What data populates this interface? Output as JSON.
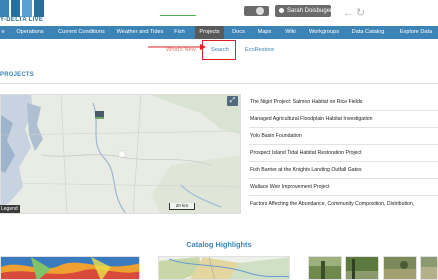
{
  "header": {
    "logo_subtitle": "Y-DELTA LIVE",
    "user_button_label": "Sarah Doisbuger",
    "icons": {
      "toggle": "toggle-switch-icon",
      "user": "user-icon",
      "back": "back-arrow-icon",
      "refresh": "refresh-icon"
    }
  },
  "nav": {
    "items": [
      {
        "label": "e"
      },
      {
        "label": "Operations"
      },
      {
        "label": "Current Conditions"
      },
      {
        "label": "Weather and Tides"
      },
      {
        "label": "Fish"
      },
      {
        "label": "Projects"
      },
      {
        "label": "Docs"
      },
      {
        "label": "Maps"
      },
      {
        "label": "Wiki"
      },
      {
        "label": "Workgroups"
      },
      {
        "label": "Data Catalog"
      },
      {
        "label": "Explore Data"
      }
    ],
    "active": "Projects"
  },
  "subtabs": {
    "items": [
      {
        "label": "What's New"
      },
      {
        "label": "Search"
      },
      {
        "label": "EcoRestore"
      }
    ]
  },
  "projects": {
    "heading": "PROJECTS",
    "map": {
      "legend_label": "Legend",
      "scale_label": "20 km"
    },
    "list": [
      "The Nigiri Project: Salmon Habitat on Rice Fields",
      "Managed Agricultural Floodplain Habitat Investigation",
      "Yolo Basin Foundation",
      "Prospect Island Tidal Habitat Restoration Project",
      "Fish Barrier at the Knights Landing Outfall Gates",
      "Wallace Weir Improvement Project",
      "Factors Affecting the Abundance, Community Composition, Distribution,"
    ]
  },
  "catalog": {
    "heading": "Catalog Highlights"
  },
  "colors": {
    "nav_blue": "#3c83b6",
    "nav_active": "#5a5a5a",
    "highlight_red": "#e02020",
    "underline_green": "#4caf50"
  }
}
